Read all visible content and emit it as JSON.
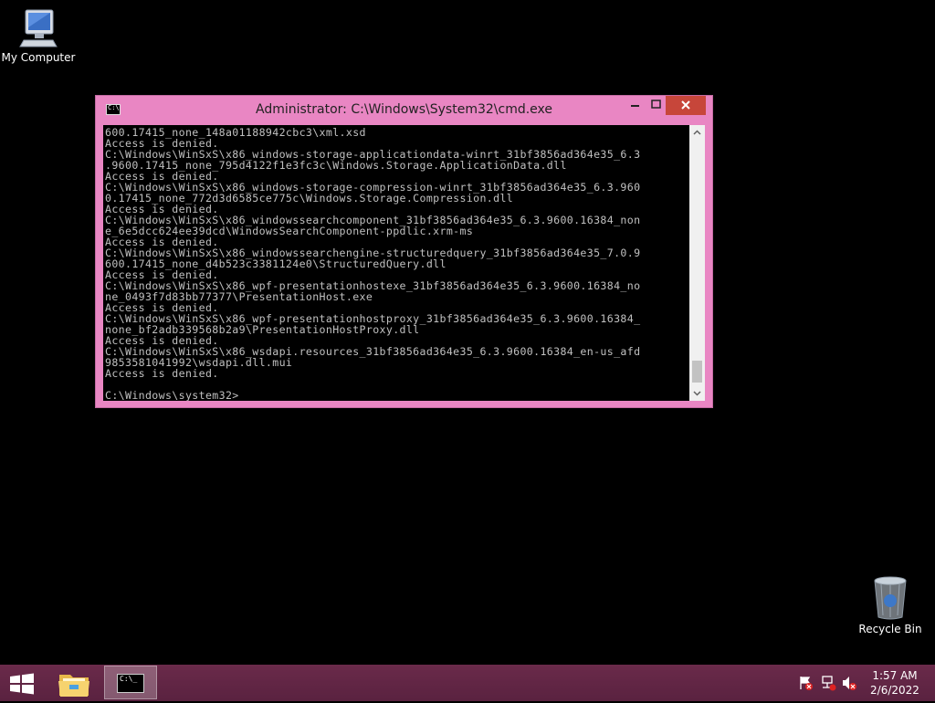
{
  "desktop": {
    "icons": [
      {
        "label": "My Computer",
        "icon": "computer-icon"
      },
      {
        "label": "Recycle Bin",
        "icon": "recycle-bin-icon"
      }
    ]
  },
  "window": {
    "title": "Administrator: C:\\Windows\\System32\\cmd.exe",
    "icon_label": "C:\\",
    "console_lines": [
      "600.17415_none_148a01188942cbc3\\xml.xsd",
      "Access is denied.",
      "C:\\Windows\\WinSxS\\x86_windows-storage-applicationdata-winrt_31bf3856ad364e35_6.3",
      ".9600.17415_none_795d4122f1e3fc3c\\Windows.Storage.ApplicationData.dll",
      "Access is denied.",
      "C:\\Windows\\WinSxS\\x86_windows-storage-compression-winrt_31bf3856ad364e35_6.3.960",
      "0.17415_none_772d3d6585ce775c\\Windows.Storage.Compression.dll",
      "Access is denied.",
      "C:\\Windows\\WinSxS\\x86_windowssearchcomponent_31bf3856ad364e35_6.3.9600.16384_non",
      "e_6e5dcc624ee39dcd\\WindowsSearchComponent-ppdlic.xrm-ms",
      "Access is denied.",
      "C:\\Windows\\WinSxS\\x86_windowssearchengine-structuredquery_31bf3856ad364e35_7.0.9",
      "600.17415_none_d4b523c3381124e0\\StructuredQuery.dll",
      "Access is denied.",
      "C:\\Windows\\WinSxS\\x86_wpf-presentationhostexe_31bf3856ad364e35_6.3.9600.16384_no",
      "ne_0493f7d83bb77377\\PresentationHost.exe",
      "Access is denied.",
      "C:\\Windows\\WinSxS\\x86_wpf-presentationhostproxy_31bf3856ad364e35_6.3.9600.16384_",
      "none_bf2adb339568b2a9\\PresentationHostProxy.dll",
      "Access is denied.",
      "C:\\Windows\\WinSxS\\x86_wsdapi.resources_31bf3856ad364e35_6.3.9600.16384_en-us_afd",
      "9853581041992\\wsdapi.dll.mui",
      "Access is denied.",
      "",
      "C:\\Windows\\system32>"
    ],
    "scroll_position": 0.93
  },
  "taskbar": {
    "buttons": [
      {
        "name": "start",
        "icon": "windows-logo-icon"
      },
      {
        "name": "file-explorer",
        "icon": "folder-icon"
      },
      {
        "name": "command-prompt",
        "icon": "cmd-icon",
        "label": "C:\\_"
      }
    ],
    "tray": [
      "flag-icon",
      "network-icon",
      "volume-icon"
    ],
    "clock": {
      "time": "1:57 AM",
      "date": "2/6/2022"
    }
  },
  "colors": {
    "window_frame": "#e986c3",
    "close_button": "#c7463a",
    "taskbar": "#5a2240"
  }
}
